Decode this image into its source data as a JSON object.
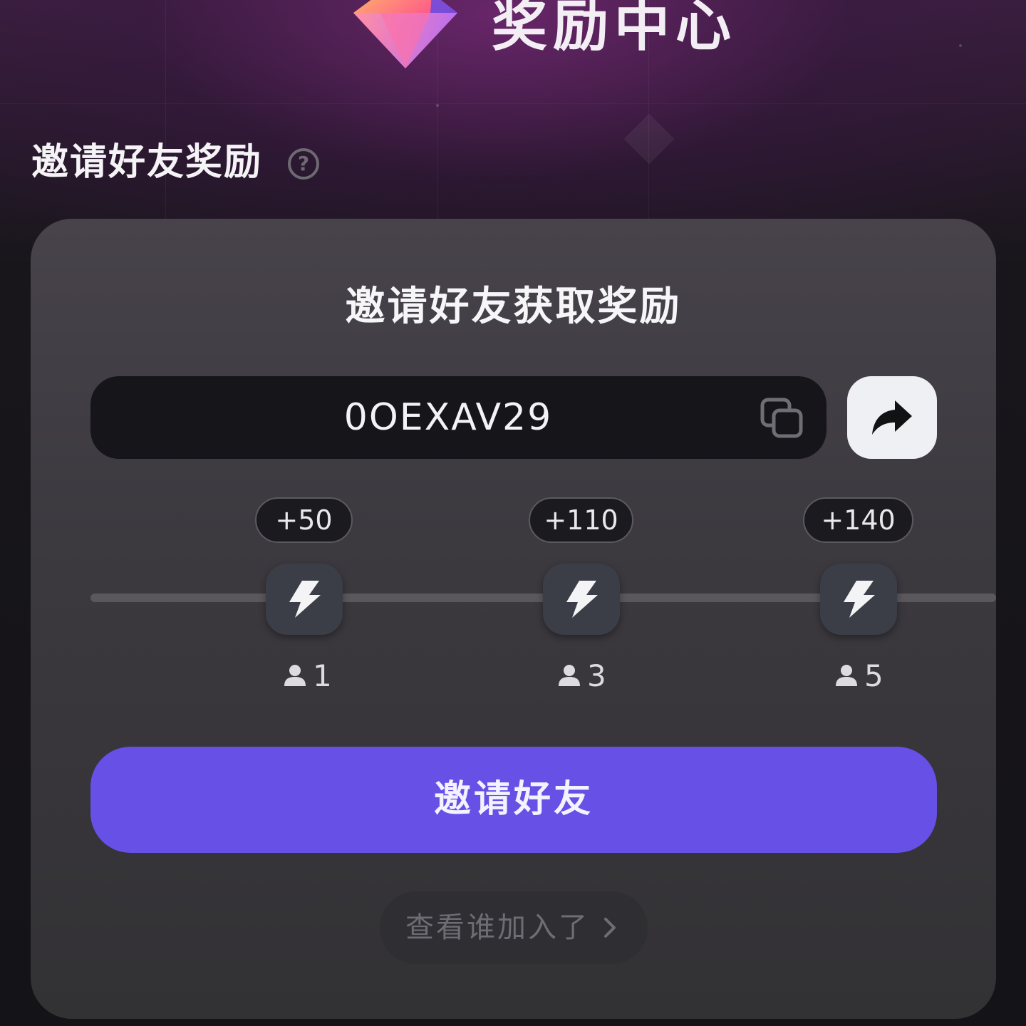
{
  "header": {
    "title": "奖励中心",
    "gem_icon": "gem-icon"
  },
  "section": {
    "title": "邀请好友奖励",
    "help_icon_glyph": "?"
  },
  "card": {
    "title": "邀请好友获取奖励",
    "invite_code": "0OEXAV29",
    "milestones": [
      {
        "reward": "+50",
        "count": "1"
      },
      {
        "reward": "+110",
        "count": "3"
      },
      {
        "reward": "+140",
        "count": "5"
      }
    ],
    "invite_button_label": "邀请好友",
    "joined_link_label": "查看谁加入了"
  },
  "colors": {
    "accent": "#6650e6",
    "card_bg": "#3d3a40",
    "code_box_bg": "#16161a",
    "share_button_bg": "#eef0f3"
  }
}
